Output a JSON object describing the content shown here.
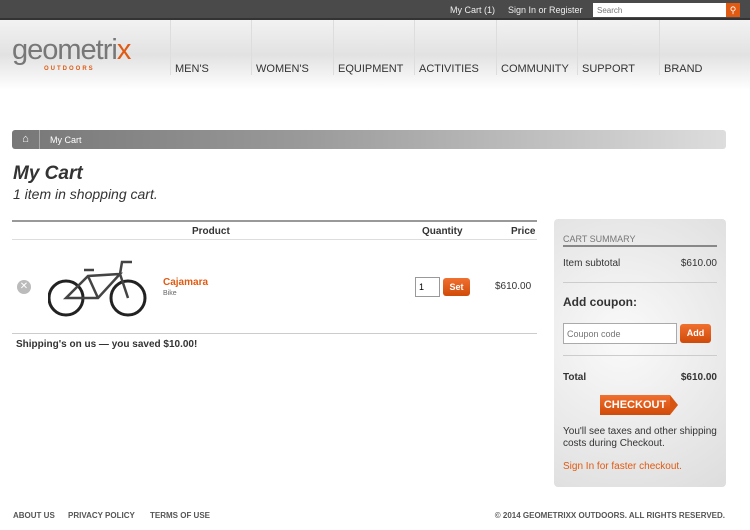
{
  "topbar": {
    "cart": "My Cart (1)",
    "signin": "Sign In or Register",
    "search_placeholder": "Search",
    "search_icon": "magnifier"
  },
  "logo": {
    "name": "geometrix",
    "sub": "OUTDOORS"
  },
  "nav": [
    "MEN'S",
    "WOMEN'S",
    "EQUIPMENT",
    "ACTIVITIES",
    "COMMUNITY",
    "SUPPORT",
    "BRAND"
  ],
  "breadcrumb": {
    "home_icon": "home",
    "current": "My Cart"
  },
  "page": {
    "title": "My Cart",
    "subtitle": "1 item in shopping cart."
  },
  "table": {
    "headers": {
      "product": "Product",
      "quantity": "Quantity",
      "price": "Price"
    },
    "items": [
      {
        "name": "Cajamara",
        "category": "Bike",
        "quantity": "1",
        "set": "Set",
        "price": "$610.00"
      }
    ]
  },
  "shipping_note": "Shipping's on us — you saved $10.00!",
  "summary": {
    "title": "CART SUMMARY",
    "subtotal_label": "Item subtotal",
    "subtotal": "$610.00",
    "coupon_label": "Add coupon:",
    "coupon_placeholder": "Coupon code",
    "add": "Add",
    "total_label": "Total",
    "total": "$610.00",
    "checkout": "CHECKOUT",
    "note": "You'll see taxes and other shipping costs during Checkout.",
    "signin_link": "Sign In for faster checkout."
  },
  "footer": {
    "links": [
      "ABOUT US",
      "PRIVACY POLICY",
      "TERMS OF USE"
    ],
    "copyright": "© 2014 GEOMETRIXX OUTDOORS. ALL RIGHTS RESERVED."
  },
  "colors": {
    "accent": "#e05a12",
    "topbar": "#4a4a4a"
  }
}
